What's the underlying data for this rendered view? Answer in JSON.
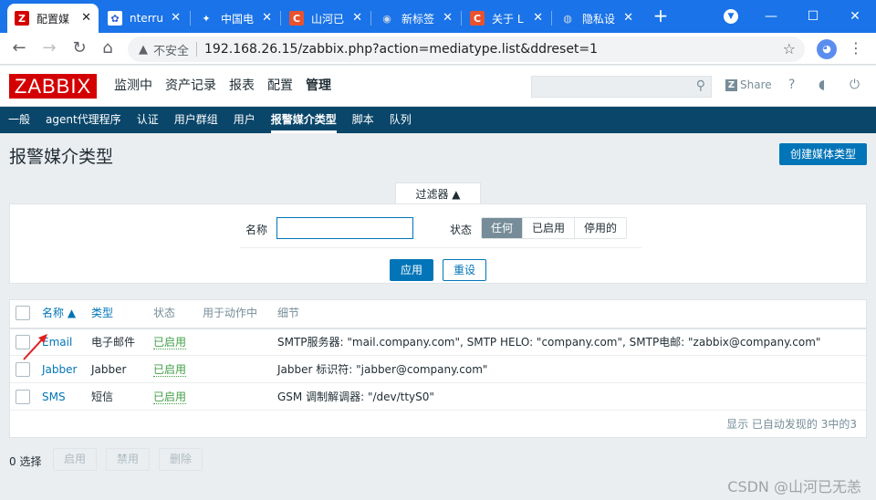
{
  "browser": {
    "tabs": [
      {
        "title": "配置媒",
        "icon": "Z",
        "color": "#d40000",
        "active": true
      },
      {
        "title": "nterru",
        "icon": "✿",
        "color": "#2f5fd8"
      },
      {
        "title": "中国电",
        "icon": "✦",
        "color": "#1a73e8"
      },
      {
        "title": "山河已",
        "icon": "C",
        "color": "#e8522f"
      },
      {
        "title": "新标签",
        "icon": "◉",
        "color": "#5f6368"
      },
      {
        "title": "关于 L",
        "icon": "C",
        "color": "#e8522f"
      },
      {
        "title": "隐私设",
        "icon": "◍",
        "color": "#5f6368"
      }
    ],
    "new_tab": "+",
    "insecure_label": "不安全",
    "url": "192.168.26.15/zabbix.php?action=mediatype.list&ddreset=1"
  },
  "header": {
    "logo": "ZABBIX",
    "nav": [
      "监测中",
      "资产记录",
      "报表",
      "配置",
      "管理"
    ],
    "active_nav": "管理",
    "share": "Share",
    "help": "?"
  },
  "subnav": {
    "items": [
      "一般",
      "agent代理程序",
      "认证",
      "用户群组",
      "用户",
      "报警媒介类型",
      "脚本",
      "队列"
    ],
    "active": "报警媒介类型"
  },
  "page": {
    "title": "报警媒介类型",
    "create_button": "创建媒体类型"
  },
  "filter": {
    "tab_label": "过滤器 ▲",
    "name_label": "名称",
    "name_value": "",
    "status_label": "状态",
    "status_options": [
      "任何",
      "已启用",
      "停用的"
    ],
    "status_selected": "任何",
    "apply": "应用",
    "reset": "重设"
  },
  "table": {
    "headers": {
      "name": "名称 ▲",
      "type": "类型",
      "status": "状态",
      "used": "用于动作中",
      "details": "细节"
    },
    "rows": [
      {
        "name": "Email",
        "type": "电子邮件",
        "status": "已启用",
        "details": "SMTP服务器: \"mail.company.com\", SMTP HELO: \"company.com\", SMTP电邮: \"zabbix@company.com\""
      },
      {
        "name": "Jabber",
        "type": "Jabber",
        "status": "已启用",
        "details": "Jabber 标识符: \"jabber@company.com\""
      },
      {
        "name": "SMS",
        "type": "短信",
        "status": "已启用",
        "details": "GSM 调制解调器: \"/dev/ttyS0\""
      }
    ],
    "footer": "显示 已自动发现的 3中的3"
  },
  "actions": {
    "selected": "0 选择",
    "enable": "启用",
    "disable": "禁用",
    "delete": "删除"
  },
  "watermark": "CSDN @山河已无恙"
}
